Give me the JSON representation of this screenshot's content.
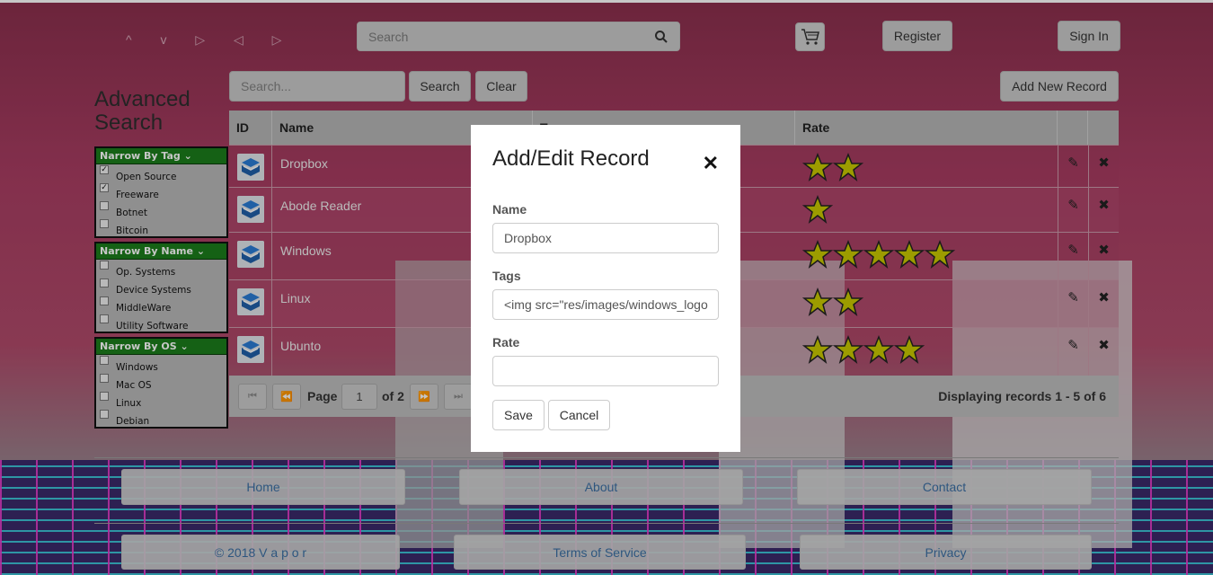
{
  "header": {
    "logo_text": "^ v ▷ ◁ ▷",
    "search_placeholder": "Search",
    "register_label": "Register",
    "signin_label": "Sign In"
  },
  "sidebar": {
    "title_line1": "Advanced",
    "title_line2": "Search",
    "groups": [
      {
        "title": "Narrow By Tag",
        "items": [
          {
            "label": "Open Source",
            "checked": "✓"
          },
          {
            "label": "Freeware",
            "checked": "✓"
          },
          {
            "label": "Botnet",
            "checked": ""
          },
          {
            "label": "Bitcoin",
            "checked": ""
          }
        ]
      },
      {
        "title": "Narrow By Name",
        "items": [
          {
            "label": "Op. Systems",
            "checked": ""
          },
          {
            "label": "Device Systems",
            "checked": ""
          },
          {
            "label": "MiddleWare",
            "checked": ""
          },
          {
            "label": "Utility Software",
            "checked": ""
          }
        ]
      },
      {
        "title": "Narrow By OS",
        "items": [
          {
            "label": "Windows",
            "checked": ""
          },
          {
            "label": "Mac OS",
            "checked": ""
          },
          {
            "label": "Linux",
            "checked": ""
          },
          {
            "label": "Debian",
            "checked": ""
          }
        ]
      }
    ]
  },
  "toolbar": {
    "search_placeholder": "Search...",
    "search_label": "Search",
    "clear_label": "Clear",
    "add_label": "Add New Record"
  },
  "table": {
    "headers": {
      "id": "ID",
      "name": "Name",
      "tags": "T",
      "rate": "Rate"
    },
    "rows": [
      {
        "name": "Dropbox",
        "rating": 2
      },
      {
        "name": "Abode Reader",
        "rating": 1
      },
      {
        "name": "Windows",
        "rating": 5
      },
      {
        "name": "Linux",
        "rating": 2
      },
      {
        "name": "Ubunto",
        "rating": 4
      }
    ]
  },
  "pager": {
    "page_label": "Page",
    "page_value": "1",
    "of_label": "of 2",
    "display_text": "Displaying records 1 - 5 of 6"
  },
  "footer": {
    "home": "Home",
    "about": "About",
    "contact": "Contact",
    "copyright": "© 2018 V a p o r",
    "terms": "Terms of Service",
    "privacy": "Privacy"
  },
  "modal": {
    "title": "Add/Edit Record",
    "close": "✕",
    "name_label": "Name",
    "name_value": "Dropbox",
    "tags_label": "Tags",
    "tags_value": "<img src=\"res/images/windows_logo",
    "rate_label": "Rate",
    "rate_value": "",
    "save_label": "Save",
    "cancel_label": "Cancel"
  },
  "colors": {
    "star_fill": "#c8c800",
    "filter_header": "#1b7d1b",
    "link": "#3c6fa3"
  }
}
